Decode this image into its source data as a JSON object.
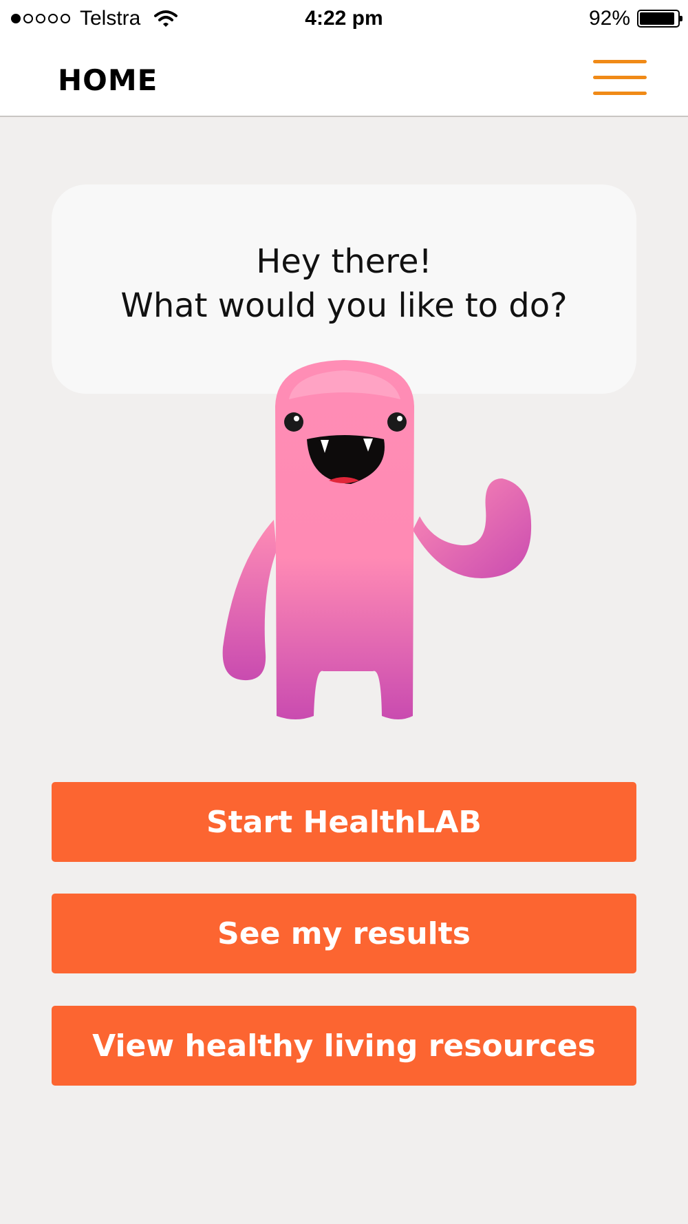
{
  "status_bar": {
    "carrier": "Telstra",
    "time": "4:22 pm",
    "battery_percent": "92%",
    "battery_level": 0.92,
    "signal_bars_filled": 1,
    "signal_bars_total": 5,
    "icons": [
      "signal-dots-icon",
      "wifi-icon",
      "battery-icon"
    ]
  },
  "header": {
    "title": "HOME",
    "menu_icon": "hamburger-menu-icon",
    "accent_color": "#f08a17"
  },
  "greeting": {
    "line1": "Hey there!",
    "line2": "What would you like to do?"
  },
  "mascot": {
    "icon": "pink-monster-mascot",
    "color": "#ff8db5"
  },
  "actions": {
    "button_color": "#fc6531",
    "start_label": "Start HealthLAB",
    "results_label": "See my results",
    "resources_label": "View healthy living resources"
  }
}
